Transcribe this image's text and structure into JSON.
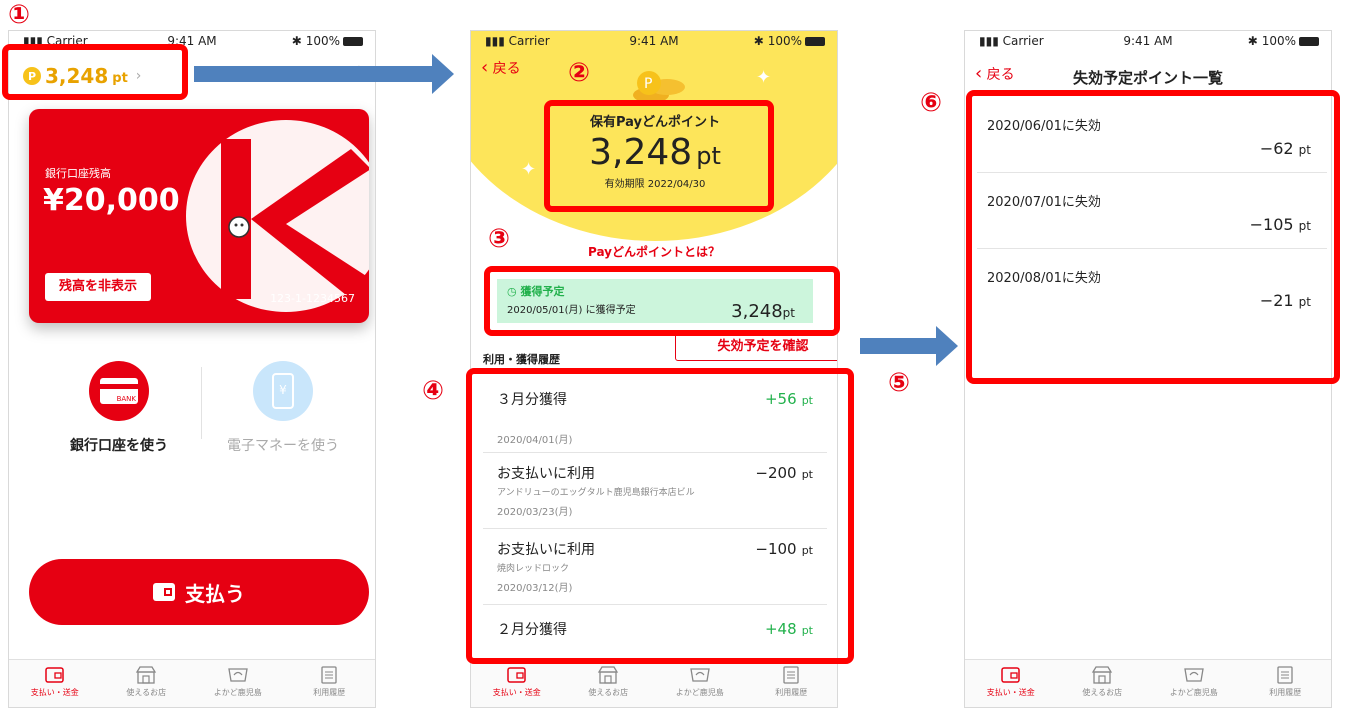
{
  "markers": {
    "m1": "①",
    "m2": "②",
    "m3": "③",
    "m4": "④",
    "m5": "⑤",
    "m6": "⑥"
  },
  "status": {
    "carrier": "Carrier",
    "time": "9:41 AM",
    "battery": "100%"
  },
  "tabs": [
    "支払い・送金",
    "使えるお店",
    "よかど鹿児島",
    "利用履歴"
  ],
  "screen1": {
    "points_value": "3,248",
    "points_unit": "pt",
    "card_label": "銀行口座残高",
    "balance": "¥20,000",
    "hide_button": "残高を非表示",
    "account_number": "123-1-1234567",
    "bank_icon_text": "BANK",
    "bank_label": "銀行口座を使う",
    "emoney_label": "電子マネーを使う",
    "pay_button": "支払う"
  },
  "screen2": {
    "back": "戻る",
    "points_title": "保有Payどんポイント",
    "points_value": "3,248",
    "points_unit": "pt",
    "expiry": "有効期限 2022/04/30",
    "about_link": "Payどんポイントとは？",
    "pending_title": "獲得予定",
    "pending_date": "2020/05/01(月) に獲得予定",
    "pending_points": "3,248",
    "pending_unit": "pt",
    "check_expiry_button": "失効予定を確認",
    "history_header": "利用・獲得履歴",
    "history": [
      {
        "title": "３月分獲得",
        "sub": "",
        "date": "2020/04/01(月)",
        "amount": "+56",
        "unit": "pt"
      },
      {
        "title": "お支払いに利用",
        "sub": "アンドリューのエッグタルト鹿児島銀行本店ビル",
        "date": "2020/03/23(月)",
        "amount": "−200",
        "unit": "pt"
      },
      {
        "title": "お支払いに利用",
        "sub": "焼肉レッドロック",
        "date": "2020/03/12(月)",
        "amount": "−100",
        "unit": "pt"
      },
      {
        "title": "２月分獲得",
        "sub": "",
        "date": "",
        "amount": "+48",
        "unit": "pt"
      }
    ]
  },
  "screen3": {
    "back": "戻る",
    "title": "失効予定ポイント一覧",
    "items": [
      {
        "date": "2020/06/01に失効",
        "amount": "−62",
        "unit": "pt"
      },
      {
        "date": "2020/07/01に失効",
        "amount": "−105",
        "unit": "pt"
      },
      {
        "date": "2020/08/01に失効",
        "amount": "−21",
        "unit": "pt"
      }
    ]
  },
  "colors": {
    "accent": "#e60012",
    "marker": "#ff0000",
    "arrow": "#4f81bd",
    "green": "#22b14c",
    "yellow": "#fde55a",
    "mint": "#ccf5dc"
  }
}
